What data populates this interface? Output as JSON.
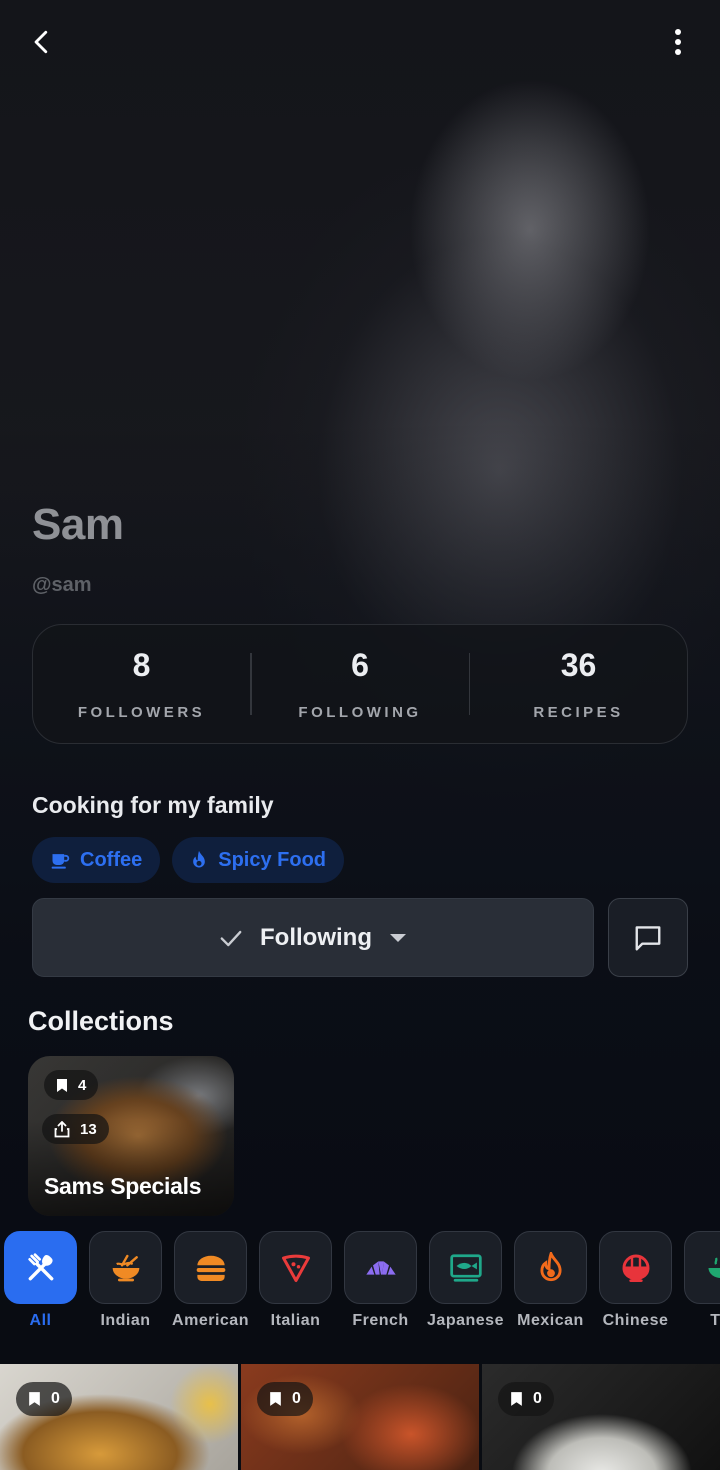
{
  "profile": {
    "name": "Sam",
    "handle": "@sam",
    "bio": "Cooking for my family"
  },
  "stats": [
    {
      "value": "8",
      "label": "FOLLOWERS"
    },
    {
      "value": "6",
      "label": "FOLLOWING"
    },
    {
      "value": "36",
      "label": "RECIPES"
    }
  ],
  "tags": [
    {
      "label": "Coffee",
      "icon": "coffee-cup-icon"
    },
    {
      "label": "Spicy Food",
      "icon": "flame-icon"
    }
  ],
  "actions": {
    "follow_label": "Following",
    "follow_icon": "checkmark-icon",
    "dropdown_icon": "caret-down-icon",
    "message_icon": "chat-bubble-icon"
  },
  "collections": {
    "title": "Collections",
    "items": [
      {
        "title": "Sams Specials",
        "saves": "4",
        "shares": "13"
      }
    ]
  },
  "cuisines": [
    {
      "label": "All",
      "icon": "fork-knife-icon",
      "active": true
    },
    {
      "label": "Indian",
      "icon": "noodle-bowl-icon"
    },
    {
      "label": "American",
      "icon": "burger-icon"
    },
    {
      "label": "Italian",
      "icon": "pizza-slice-icon"
    },
    {
      "label": "French",
      "icon": "croissant-icon"
    },
    {
      "label": "Japanese",
      "icon": "fish-icon"
    },
    {
      "label": "Mexican",
      "icon": "chili-flame-icon"
    },
    {
      "label": "Chinese",
      "icon": "rice-bowl-icon"
    },
    {
      "label": "Th",
      "icon": "soup-icon"
    }
  ],
  "recipes": [
    {
      "saves": "0"
    },
    {
      "saves": "0"
    },
    {
      "saves": "0"
    }
  ],
  "colors": {
    "accent": "#2a6df0",
    "tag_bg": "#0f1f3d",
    "background": "#090c12"
  }
}
